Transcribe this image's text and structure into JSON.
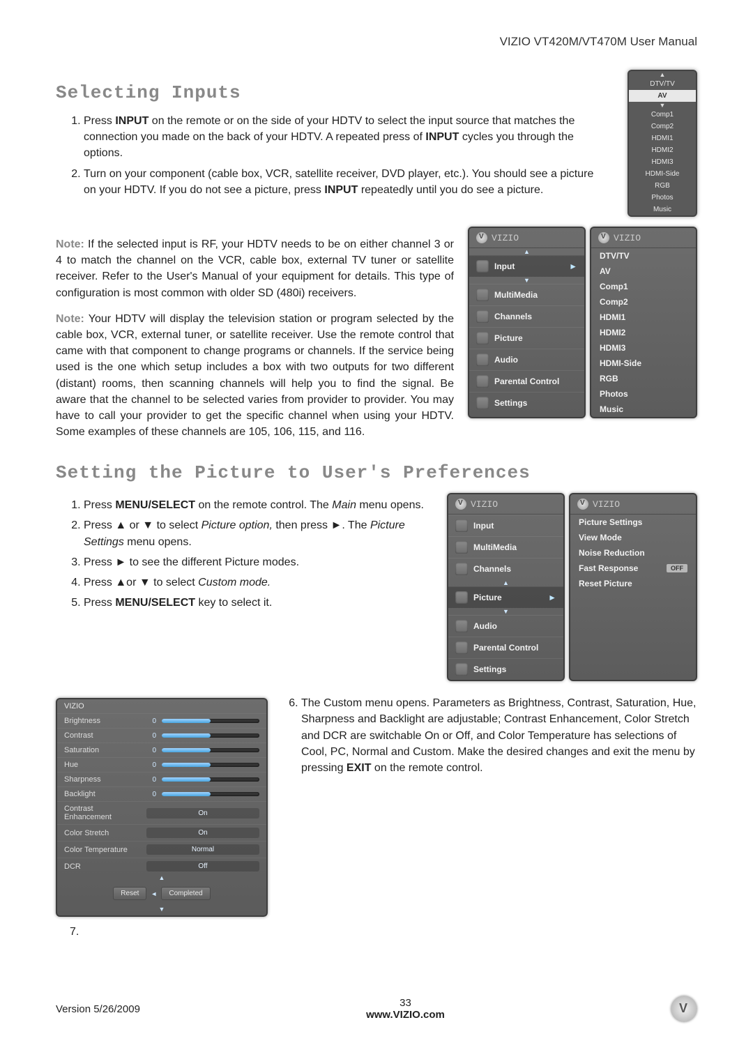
{
  "doc_title": "VIZIO VT420M/VT470M User Manual",
  "headings": {
    "selecting_inputs": "Selecting Inputs",
    "setting_picture": "Setting the Picture to User's Preferences"
  },
  "inputs_steps": {
    "step1_a": "Press ",
    "step1_b": "INPUT",
    "step1_c": " on the remote or on the side of your HDTV to select the input source that matches the connection you made on the back of your HDTV. A repeated press of ",
    "step1_d": "INPUT",
    "step1_e": " cycles you through the options.",
    "step2_a": "Turn on your component (cable box, VCR, satellite receiver, DVD player, etc.). You should see a picture on your HDTV. If you do not see a picture, press ",
    "step2_b": "INPUT",
    "step2_c": " repeatedly until you do see a picture."
  },
  "notes": {
    "label": "Note:",
    "note1": " If the selected input is RF, your HDTV needs to be on either channel 3 or 4 to match the channel on the VCR, cable box, external TV tuner or satellite receiver. Refer to the User's Manual of your equipment for details. This type of configuration is most common with older SD (480i) receivers.",
    "note2": " Your HDTV will display the television station or program selected by the cable box, VCR, external tuner, or satellite receiver. Use the remote control that came with that component to change programs or channels. If the service being used is the one which setup includes a box with two outputs for two different (distant) rooms, then scanning channels will help you to find the signal. Be aware that the channel to be selected varies from provider to provider. You may have to call your provider to get the specific channel when using your HDTV. Some examples of these channels are 105, 106, 115, and 116."
  },
  "input_list": {
    "top": "DTV/TV",
    "highlight": "AV",
    "rest": [
      "Comp1",
      "Comp2",
      "HDMI1",
      "HDMI2",
      "HDMI3",
      "HDMI-Side",
      "RGB",
      "Photos",
      "Music"
    ]
  },
  "brand": "VIZIO",
  "main_menu": [
    "Input",
    "MultiMedia",
    "Channels",
    "Picture",
    "Audio",
    "Parental Control",
    "Settings"
  ],
  "input_submenu": [
    "DTV/TV",
    "AV",
    "Comp1",
    "Comp2",
    "HDMI1",
    "HDMI2",
    "HDMI3",
    "HDMI-Side",
    "RGB",
    "Photos",
    "Music"
  ],
  "picture_steps": {
    "s1a": "Press ",
    "s1b": "MENU/SELECT",
    "s1c": " on the remote control. The ",
    "s1d": "Main",
    "s1e": " menu opens.",
    "s2a": "Press ▲ or ▼ to select ",
    "s2b": "Picture option,",
    "s2c": " then press ►. The ",
    "s2d": "Picture Settings",
    "s2e": " menu opens.",
    "s3": "Press ► to see the different Picture modes.",
    "s4a": "Press ▲or ▼ to select ",
    "s4b": "Custom mode.",
    "s5a": "Press ",
    "s5b": "MENU/SELECT",
    "s5c": " key to select it."
  },
  "picture_submenu": {
    "title": "Picture Settings",
    "items": [
      "View Mode",
      "Noise Reduction",
      "Fast Response",
      "Reset Picture"
    ],
    "off_pill": "OFF"
  },
  "sliders": {
    "rows": [
      {
        "name": "Brightness",
        "val": "0"
      },
      {
        "name": "Contrast",
        "val": "0"
      },
      {
        "name": "Saturation",
        "val": "0"
      },
      {
        "name": "Hue",
        "val": "0"
      },
      {
        "name": "Sharpness",
        "val": "0"
      },
      {
        "name": "Backlight",
        "val": "0"
      }
    ],
    "modes": [
      {
        "name": "Contrast Enhancement",
        "value": "On"
      },
      {
        "name": "Color Stretch",
        "value": "On"
      },
      {
        "name": "Color Temperature",
        "value": "Normal"
      },
      {
        "name": "DCR",
        "value": "Off"
      }
    ],
    "btn_reset": "Reset",
    "btn_completed": "Completed"
  },
  "step6_a": "The Custom menu opens. Parameters as Brightness, Contrast, Saturation, Hue, Sharpness and Backlight are adjustable; Contrast Enhancement, Color Stretch and DCR are switchable On or Off, and Color Temperature has selections of Cool, PC, Normal and Custom. Make the desired changes and exit the menu by pressing ",
  "step6_b": "EXIT",
  "step6_c": " on the remote control.",
  "step7": "7.",
  "footer": {
    "version": "Version 5/26/2009",
    "page": "33",
    "url": "www.VIZIO.com"
  }
}
